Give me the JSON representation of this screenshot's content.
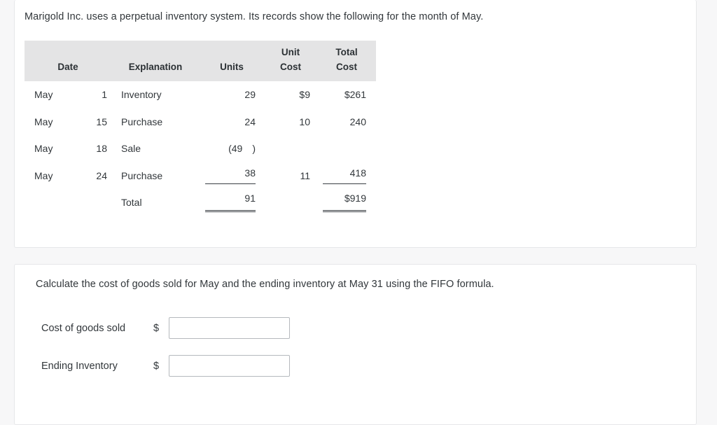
{
  "question_card": {
    "intro_text": "Marigold Inc. uses a perpetual inventory system. Its records show the following for the month of May.",
    "table": {
      "headers": {
        "date": "Date",
        "explanation": "Explanation",
        "units": "Units",
        "unit_cost_line1": "Unit",
        "unit_cost_line2": "Cost",
        "total_cost_line1": "Total",
        "total_cost_line2": "Cost"
      },
      "rows": [
        {
          "month": "May",
          "day": "1",
          "explanation": "Inventory",
          "units": "29",
          "unit_cost": "$9",
          "total_cost": "$261"
        },
        {
          "month": "May",
          "day": "15",
          "explanation": "Purchase",
          "units": "24",
          "unit_cost": "10",
          "total_cost": "240"
        },
        {
          "month": "May",
          "day": "18",
          "explanation": "Sale",
          "units_open": "(49",
          "units_close": ")",
          "unit_cost": "",
          "total_cost": ""
        },
        {
          "month": "May",
          "day": "24",
          "explanation": "Purchase",
          "units": "38",
          "unit_cost": "11",
          "total_cost": "418"
        }
      ],
      "total_row": {
        "month": "",
        "day": "",
        "explanation": "Total",
        "units": "91",
        "unit_cost": "",
        "total_cost": "$919"
      }
    }
  },
  "answer_card": {
    "instruction_text": "Calculate the cost of goods sold for May and the ending inventory at May 31 using the FIFO formula.",
    "fields": [
      {
        "label": "Cost of goods sold",
        "currency_symbol": "$",
        "value": "",
        "placeholder": ""
      },
      {
        "label": "Ending Inventory",
        "currency_symbol": "$",
        "value": "",
        "placeholder": ""
      }
    ]
  },
  "colors": {
    "page_background": "#f7f7f8",
    "card_background": "#ffffff",
    "card_border": "#e6e7e9",
    "table_header_background": "#e4e4e5",
    "text": "#32373b",
    "rule": "#3a3f44",
    "input_border": "#b5b9bd"
  }
}
